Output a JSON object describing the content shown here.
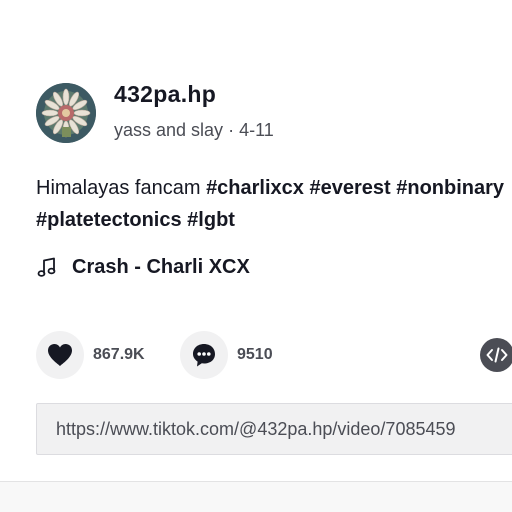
{
  "author": {
    "username": "432pa.hp",
    "nickname": "yass and slay",
    "separator": " · ",
    "date": "4-11",
    "avatar_icon": "flower-avatar-icon"
  },
  "caption": {
    "text": "Himalayas fancam ",
    "hashtags_line1": [
      "#charlixcx",
      "#everest",
      "#nonbinary"
    ],
    "hashtags_line2": [
      "#platetectonics",
      "#lgbt"
    ]
  },
  "music": {
    "icon": "music-note-icon",
    "title": "Crash - Charli XCX"
  },
  "actions": {
    "likes": "867.9K",
    "comments": "9510",
    "like_icon": "heart-icon",
    "comment_icon": "comment-bubble-icon",
    "embed_icon": "embed-code-icon"
  },
  "share": {
    "url": "https://www.tiktok.com/@432pa.hp/video/7085459"
  },
  "colors": {
    "text_primary": "#161823",
    "text_secondary": "#4b4d55",
    "button_bg": "#f1f1f2"
  }
}
